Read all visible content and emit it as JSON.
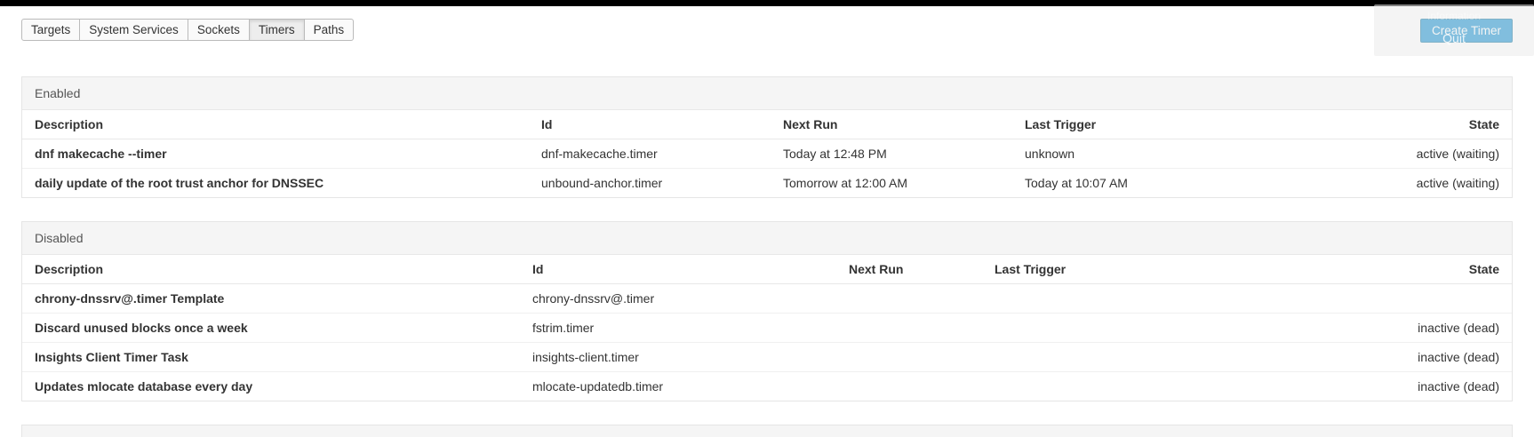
{
  "tabs": {
    "targets": "Targets",
    "system_services": "System Services",
    "sockets": "Sockets",
    "timers": "Timers",
    "paths": "Paths",
    "active": "timers"
  },
  "buttons": {
    "create_timer": "Create Timer"
  },
  "ghost": {
    "line1": "Information",
    "line2": "Quit"
  },
  "columns": {
    "description": "Description",
    "id": "Id",
    "next_run": "Next Run",
    "last_trigger": "Last Trigger",
    "state": "State"
  },
  "sections": {
    "enabled": {
      "title": "Enabled",
      "rows": [
        {
          "description": "dnf makecache --timer",
          "id": "dnf-makecache.timer",
          "next_run": "Today at 12:48 PM",
          "last_trigger": "unknown",
          "state": "active (waiting)"
        },
        {
          "description": "daily update of the root trust anchor for DNSSEC",
          "id": "unbound-anchor.timer",
          "next_run": "Tomorrow at 12:00 AM",
          "last_trigger": "Today at 10:07 AM",
          "state": "active (waiting)"
        }
      ]
    },
    "disabled": {
      "title": "Disabled",
      "rows": [
        {
          "description": "chrony-dnssrv@.timer Template",
          "id": "chrony-dnssrv@.timer",
          "next_run": "",
          "last_trigger": "",
          "state": ""
        },
        {
          "description": "Discard unused blocks once a week",
          "id": "fstrim.timer",
          "next_run": "",
          "last_trigger": "",
          "state": "inactive (dead)"
        },
        {
          "description": "Insights Client Timer Task",
          "id": "insights-client.timer",
          "next_run": "",
          "last_trigger": "",
          "state": "inactive (dead)"
        },
        {
          "description": "Updates mlocate database every day",
          "id": "mlocate-updatedb.timer",
          "next_run": "",
          "last_trigger": "",
          "state": "inactive (dead)"
        }
      ]
    }
  }
}
